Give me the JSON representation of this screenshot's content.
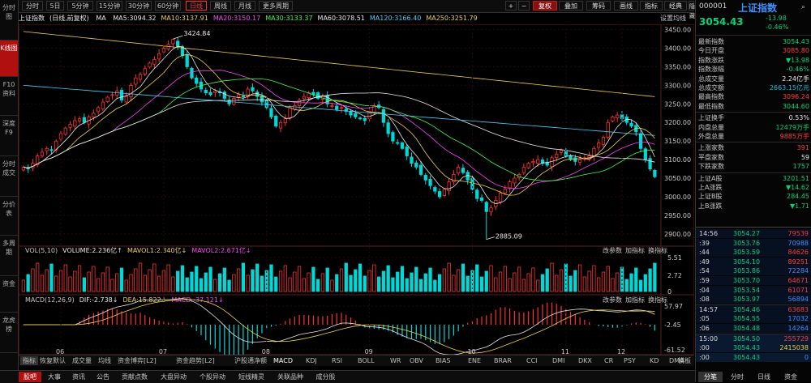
{
  "left_tabs": [
    "分时图",
    "K线图",
    "F10资料",
    "深度F9",
    "分时成交",
    "分价表",
    "多周期",
    "资金",
    "龙虎榜"
  ],
  "toolbar": {
    "periods": [
      "分时",
      "5日",
      "5分钟",
      "15分钟",
      "30分钟",
      "60分钟",
      "日线",
      "周线",
      "月线",
      "更多周期"
    ],
    "active_period": "日线",
    "right_buttons": [
      "复权",
      "叠加",
      "筹码",
      "画线",
      "指标",
      "经典",
      "隐藏"
    ],
    "plus": "+",
    "minus": "−"
  },
  "ma_line": {
    "name": "上证指数",
    "desc": "(日线,前复权)",
    "ma_label": "MA",
    "items": [
      {
        "text": "MA5:3094.32",
        "color": "#e8e8e8"
      },
      {
        "text": "MA10:3137.91",
        "color": "#f0d040"
      },
      {
        "text": "MA20:3150.17",
        "color": "#ff40ff"
      },
      {
        "text": "MA30:3133.37",
        "color": "#40ff40"
      },
      {
        "text": "MA60:3078.51",
        "color": "#e8e8e8"
      },
      {
        "text": "MA120:3166.40",
        "color": "#40d0ff"
      },
      {
        "text": "MA250:3251.79",
        "color": "#f0d040"
      }
    ],
    "settings": "设置均线"
  },
  "chart_data": {
    "type": "candlestick",
    "price_axis": [
      "3450.00",
      "3400.00",
      "3350.00",
      "3300.00",
      "3250.00",
      "3200.00",
      "3150.00",
      "3100.00",
      "3050.00",
      "3000.00",
      "2950.00",
      "2900.00"
    ],
    "ylim": [
      2880,
      3460
    ],
    "months": [
      "06",
      "07",
      "08",
      "09",
      "10",
      "11",
      "12"
    ],
    "high_label": "3424.84",
    "low_label": "2885.09",
    "closes": [
      3080,
      3075,
      3090,
      3110,
      3120,
      3130,
      3125,
      3150,
      3170,
      3185,
      3195,
      3205,
      3210,
      3200,
      3215,
      3225,
      3240,
      3255,
      3268,
      3275,
      3285,
      3260,
      3270,
      3300,
      3320,
      3330,
      3345,
      3360,
      3370,
      3385,
      3400,
      3410,
      3424,
      3405,
      3380,
      3350,
      3320,
      3305,
      3290,
      3280,
      3275,
      3285,
      3280,
      3265,
      3250,
      3265,
      3275,
      3270,
      3290,
      3285,
      3270,
      3255,
      3240,
      3215,
      3190,
      3200,
      3210,
      3240,
      3245,
      3260,
      3270,
      3280,
      3275,
      3265,
      3270,
      3250,
      3245,
      3235,
      3240,
      3230,
      3220,
      3215,
      3210,
      3205,
      3230,
      3245,
      3240,
      3200,
      3170,
      3150,
      3145,
      3130,
      3110,
      3090,
      3080,
      3060,
      3045,
      3030,
      3015,
      3000,
      3020,
      3040,
      3060,
      3080,
      3065,
      3045,
      3020,
      2995,
      2990,
      2960,
      2970,
      2990,
      3010,
      3020,
      3040,
      3050,
      3060,
      3080,
      3090,
      3095,
      3100,
      3090,
      3085,
      3105,
      3115,
      3125,
      3110,
      3100,
      3095,
      3100,
      3105,
      3110,
      3130,
      3145,
      3160,
      3200,
      3215,
      3220,
      3210,
      3200,
      3190,
      3175,
      3130,
      3100,
      3075,
      3054
    ],
    "volume_axis": [
      "5.51",
      "2.72",
      "0"
    ],
    "volume_label": "VOL(5,10)",
    "volume_text": "VOLUME:2.236亿↑",
    "mavol1_text": "MAVOL1:2.340亿↓",
    "mavol2_text": "MAVOL2:2.671亿↓",
    "macd_axis": [
      "57.97",
      "-2.45",
      "-61.52"
    ],
    "macd_label": "MACD(12,26,9)",
    "dif_text": "DIF:-2.738↓",
    "dea_text": "DEA:15.822↓",
    "macd_text": "MACD:-37.121↓",
    "sub_buttons": [
      "改参数",
      "加指标",
      "换指标"
    ]
  },
  "indicator_bar": [
    "指标",
    "恢复默认",
    "成交量",
    "均线",
    "资金博弈[L2]",
    "资金趋势[L2]",
    "沪股通净额",
    "MACD",
    "KDJ",
    "RSI",
    "BOLL",
    "WR",
    "OBV",
    "BIAS",
    "ENE",
    "BRAR",
    "CCI",
    "DMI",
    "DKX",
    "CR",
    "PSY",
    "KD",
    "DMA",
    "更多",
    "模板"
  ],
  "bottom_tabs": [
    "股吧",
    "大事",
    "资讯",
    "公告",
    "贡献点数",
    "大盘异动",
    "个股异动",
    "短线精灵",
    "关联品种",
    "成分股"
  ],
  "quote": {
    "code": "000001",
    "name": "上证指数",
    "price": "3054.43",
    "change": "-13.98",
    "pct": "-0.46%",
    "rows": [
      {
        "label": "最新指数",
        "value": "3054.43",
        "color": "green"
      },
      {
        "label": "今日开盘",
        "value": "3085.80",
        "color": "red"
      },
      {
        "label": "指数涨跌",
        "value": "▼13.98",
        "color": "green"
      },
      {
        "label": "指数涨幅",
        "value": "-0.46%",
        "color": "green"
      },
      {
        "label": "总成交量",
        "value": "2.24亿手",
        "color": "white"
      },
      {
        "label": "总成交额",
        "value": "2663.15亿元",
        "color": "cyan"
      },
      {
        "label": "最高指数",
        "value": "3096.24",
        "color": "red"
      },
      {
        "label": "最低指数",
        "value": "3044.60",
        "color": "green"
      },
      {
        "label": "上证换手",
        "value": "0.53%",
        "color": "white"
      },
      {
        "label": "内盘总量",
        "value": "12479万手",
        "color": "green"
      },
      {
        "label": "外盘总量",
        "value": "9885万手",
        "color": "red"
      },
      {
        "label": "上涨家数",
        "value": "391",
        "color": "red"
      },
      {
        "label": "平盘家数",
        "value": "59",
        "color": "white"
      },
      {
        "label": "下跌家数",
        "value": "1757",
        "color": "green"
      },
      {
        "label": "上证A股",
        "value": "3201.51",
        "color": "green"
      },
      {
        "label": "上A涨跌",
        "value": "▼14.62",
        "color": "green"
      },
      {
        "label": "上证B股",
        "value": "284.45",
        "color": "green"
      },
      {
        "label": "上B涨跌",
        "value": "▼1.71",
        "color": "green"
      }
    ],
    "ticks": [
      {
        "t": "14:56",
        "p": "3054.27",
        "v": "79539"
      },
      {
        "t": ":39",
        "p": "3053.76",
        "v": "70988"
      },
      {
        "t": ":44",
        "p": "3053.59",
        "v": "84626"
      },
      {
        "t": ":49",
        "p": "3054.10",
        "v": "89251"
      },
      {
        "t": ":54",
        "p": "3053.86",
        "v": "72284"
      },
      {
        "t": ":59",
        "p": "3053.70",
        "v": "64671"
      },
      {
        "t": ":04",
        "p": "3053.54",
        "v": "61071"
      },
      {
        "t": ":08",
        "p": "3053.97",
        "v": "56894"
      },
      {
        "t": "14:57",
        "p": "3054.46",
        "v": "63683"
      },
      {
        "t": ":05",
        "p": "3054.55",
        "v": "17032"
      },
      {
        "t": ":06",
        "p": "3054.48",
        "v": "14264"
      },
      {
        "t": "15:00",
        "p": "3054.50",
        "v": "255729"
      },
      {
        "t": ":00",
        "p": "3054.43",
        "v": "2415038"
      },
      {
        "t": ":00",
        "p": "3054.43",
        "v": "0"
      }
    ],
    "bottom_tabs": [
      "分笔",
      "分时",
      "日线",
      "资金"
    ]
  }
}
